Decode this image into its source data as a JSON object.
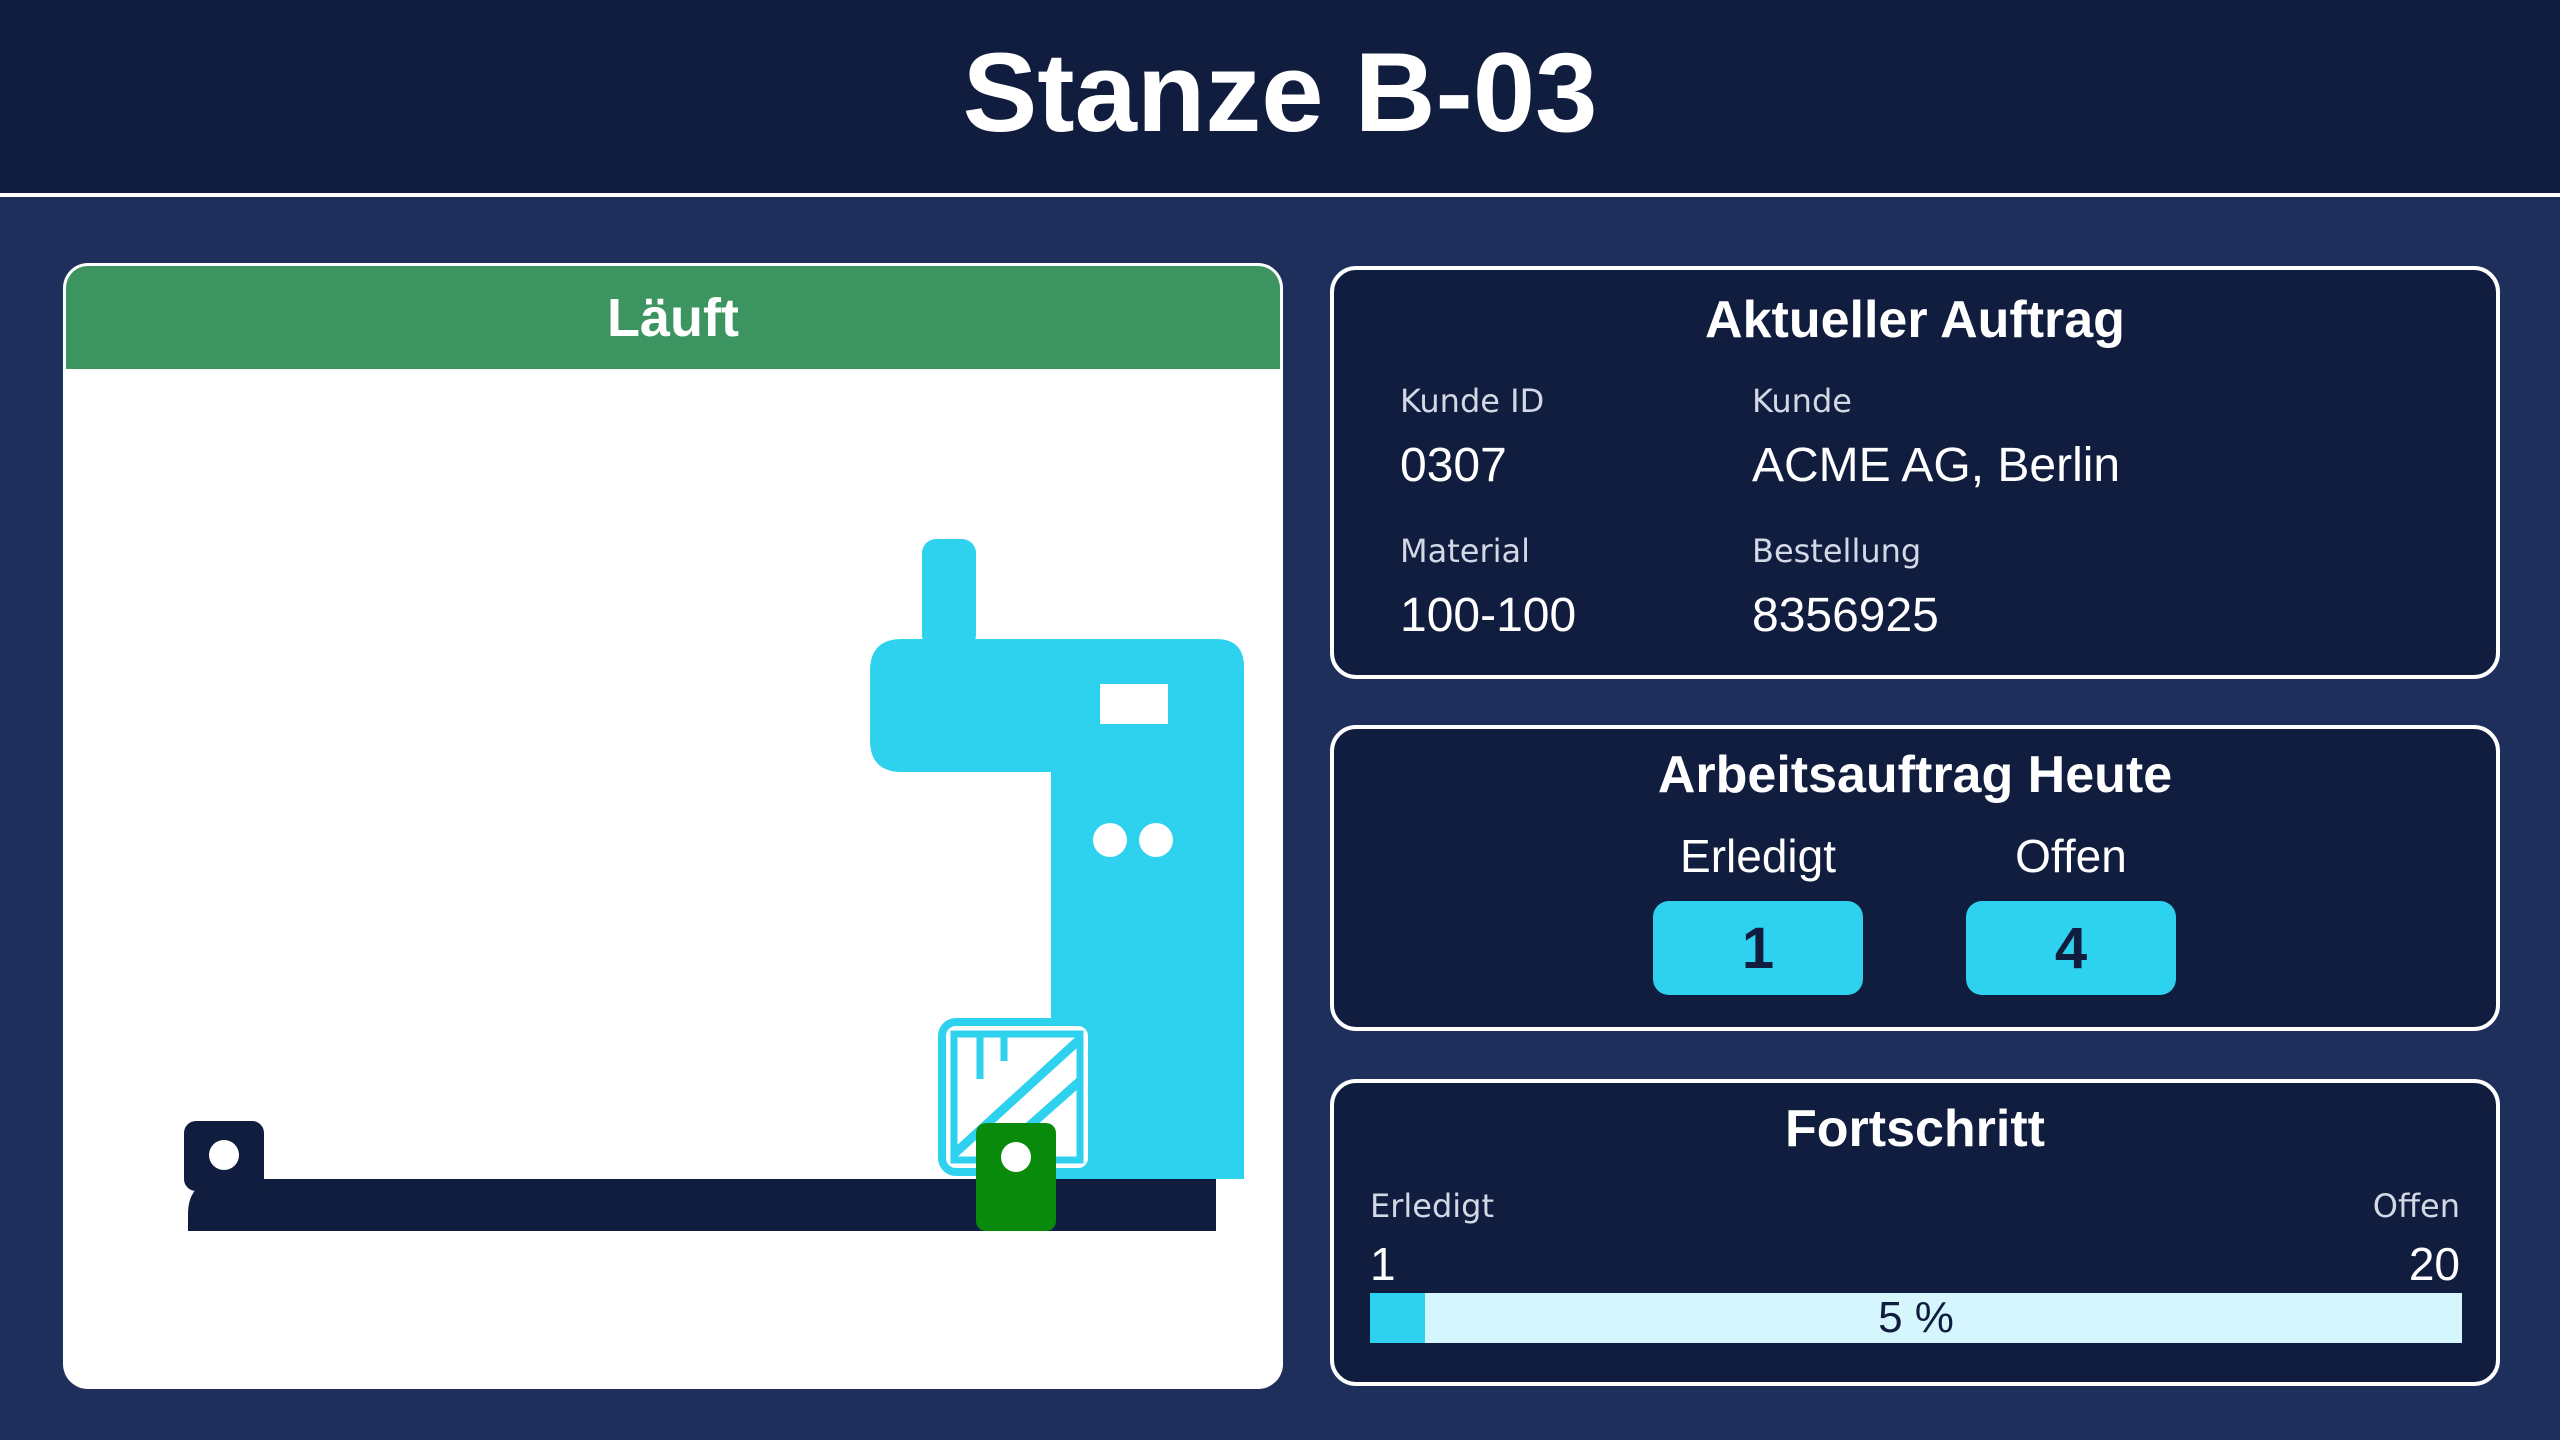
{
  "header": {
    "title": "Stanze B-03"
  },
  "machine": {
    "status": "Läuft",
    "status_color": "#3c9460",
    "machine_color": "#2fd2ee",
    "conveyor_color": "#111d3e",
    "part_color": "#0a8a0a"
  },
  "order": {
    "title": "Aktueller Auftrag",
    "customer_id_label": "Kunde ID",
    "customer_id": "0307",
    "customer_label": "Kunde",
    "customer": "ACME AG, Berlin",
    "material_label": "Material",
    "material": "100-100",
    "order_label": "Bestellung",
    "order_no": "8356925"
  },
  "today": {
    "title": "Arbeitsauftrag Heute",
    "done_label": "Erledigt",
    "done": "1",
    "open_label": "Offen",
    "open": "4"
  },
  "progress": {
    "title": "Fortschritt",
    "done_label": "Erledigt",
    "done": "1",
    "open_label": "Offen",
    "open": "20",
    "percent_text": "5 %",
    "fraction": 0.05
  }
}
